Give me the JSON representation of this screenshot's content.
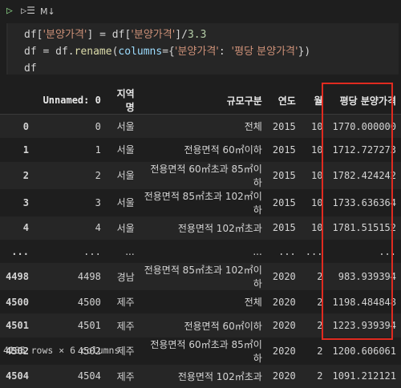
{
  "toolbar": {
    "run_icon": "play-icon",
    "run_below_icon": "run-below-icon",
    "markdown_label": "M↓"
  },
  "code_lines": [
    {
      "a": "df[",
      "b": "'분양가격'",
      "c": "] = df[",
      "d": "'분양가격'",
      "e": "]/",
      "f": "3.3"
    },
    {
      "a": "df = df.",
      "fn": "rename",
      "p": "(",
      "kw": "columns",
      "eq": "={",
      "s1": "'분양가격'",
      "colon": ": ",
      "s2": "'평당 분양가격'",
      "end": "})"
    },
    {
      "a": "df"
    }
  ],
  "table": {
    "headers": [
      "",
      "Unnamed: 0",
      "지역명",
      "규모구분",
      "연도",
      "월",
      "평당 분양가격"
    ],
    "rows": [
      [
        "0",
        "0",
        "서울",
        "전체",
        "2015",
        "10",
        "1770.000000"
      ],
      [
        "1",
        "1",
        "서울",
        "전용면적 60㎡이하",
        "2015",
        "10",
        "1712.727273"
      ],
      [
        "2",
        "2",
        "서울",
        "전용면적 60㎡초과 85㎡이하",
        "2015",
        "10",
        "1782.424242"
      ],
      [
        "3",
        "3",
        "서울",
        "전용면적 85㎡초과 102㎡이하",
        "2015",
        "10",
        "1733.636364"
      ],
      [
        "4",
        "4",
        "서울",
        "전용면적 102㎡초과",
        "2015",
        "10",
        "1781.515152"
      ],
      [
        "...",
        "...",
        "...",
        "...",
        "...",
        "...",
        "..."
      ],
      [
        "4498",
        "4498",
        "경남",
        "전용면적 85㎡초과 102㎡이하",
        "2020",
        "2",
        "983.939394"
      ],
      [
        "4500",
        "4500",
        "제주",
        "전체",
        "2020",
        "2",
        "1198.484848"
      ],
      [
        "4501",
        "4501",
        "제주",
        "전용면적 60㎡이하",
        "2020",
        "2",
        "1223.939394"
      ],
      [
        "4502",
        "4502",
        "제주",
        "전용면적 60㎡초과 85㎡이하",
        "2020",
        "2",
        "1200.606061"
      ],
      [
        "4504",
        "4504",
        "제주",
        "전용면적 102㎡초과",
        "2020",
        "2",
        "1091.212121"
      ]
    ]
  },
  "footer": "4185 rows × 6 columns",
  "highlight_color": "#e02b20"
}
